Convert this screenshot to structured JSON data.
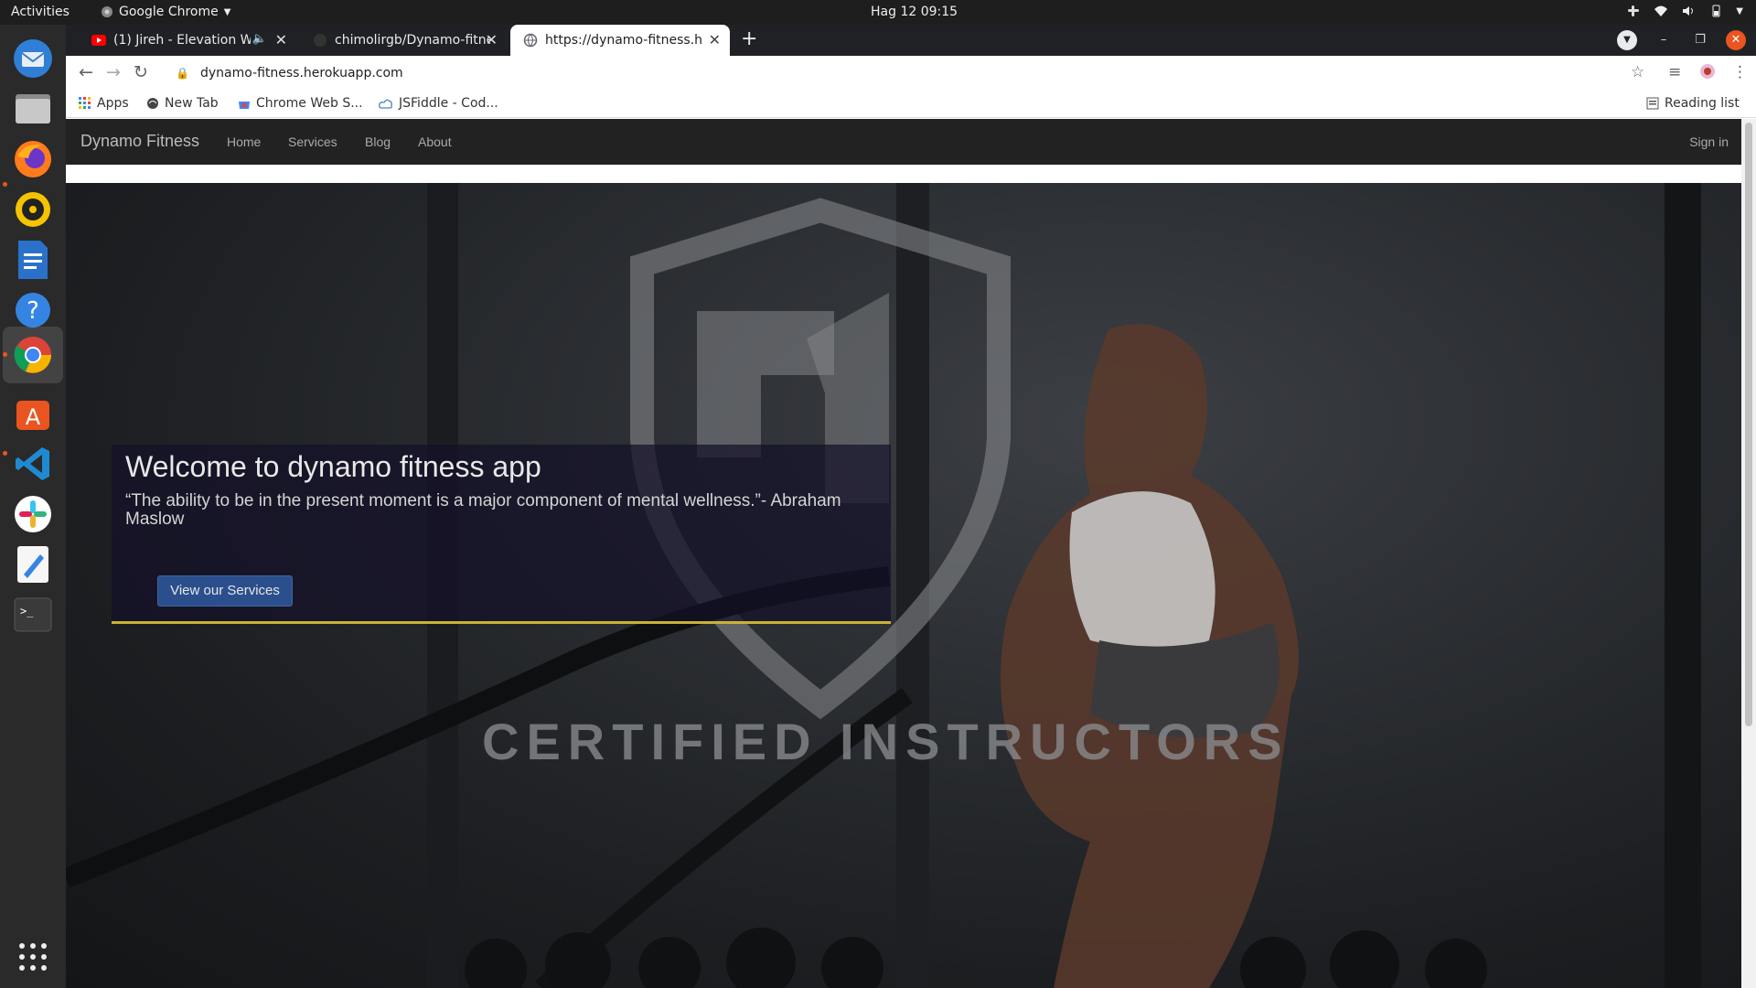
{
  "topbar": {
    "activities": "Activities",
    "app_name": "Google Chrome",
    "clock": "Hag 12  09:15"
  },
  "browser": {
    "tabs": [
      {
        "title": "(1) Jireh - Elevation W",
        "favicon": "youtube-icon",
        "audio": "speaker-icon",
        "active": false
      },
      {
        "title": "chimolirgb/Dynamo-fitne",
        "favicon": "github-icon",
        "active": false
      },
      {
        "title": "https://dynamo-fitness.h",
        "favicon": "globe-icon",
        "active": true
      }
    ],
    "url": "dynamo-fitness.herokuapp.com",
    "bookmarks": [
      {
        "label": "Apps",
        "icon": "apps-grid-icon"
      },
      {
        "label": "New Tab",
        "icon": "globe-icon"
      },
      {
        "label": "Chrome Web S...",
        "icon": "chrome-webstore-icon"
      },
      {
        "label": "JSFiddle - Cod...",
        "icon": "cloud-icon"
      }
    ],
    "reading_list": "Reading list"
  },
  "site": {
    "brand": "Dynamo Fitness",
    "nav": [
      "Home",
      "Services",
      "Blog",
      "About"
    ],
    "signin": "Sign in",
    "hero": {
      "title": "Welcome to dynamo fitness app",
      "quote": "“The ability to be in the present moment is a major component of mental wellness.”- Abraham Maslow",
      "button": "View our Services",
      "background_text": "CERTIFIED INSTRUCTORS"
    }
  },
  "colors": {
    "navbar": "#222222",
    "button": "#2b4f8c",
    "accent_line": "#c9b237",
    "welcome_box": "#141028"
  }
}
